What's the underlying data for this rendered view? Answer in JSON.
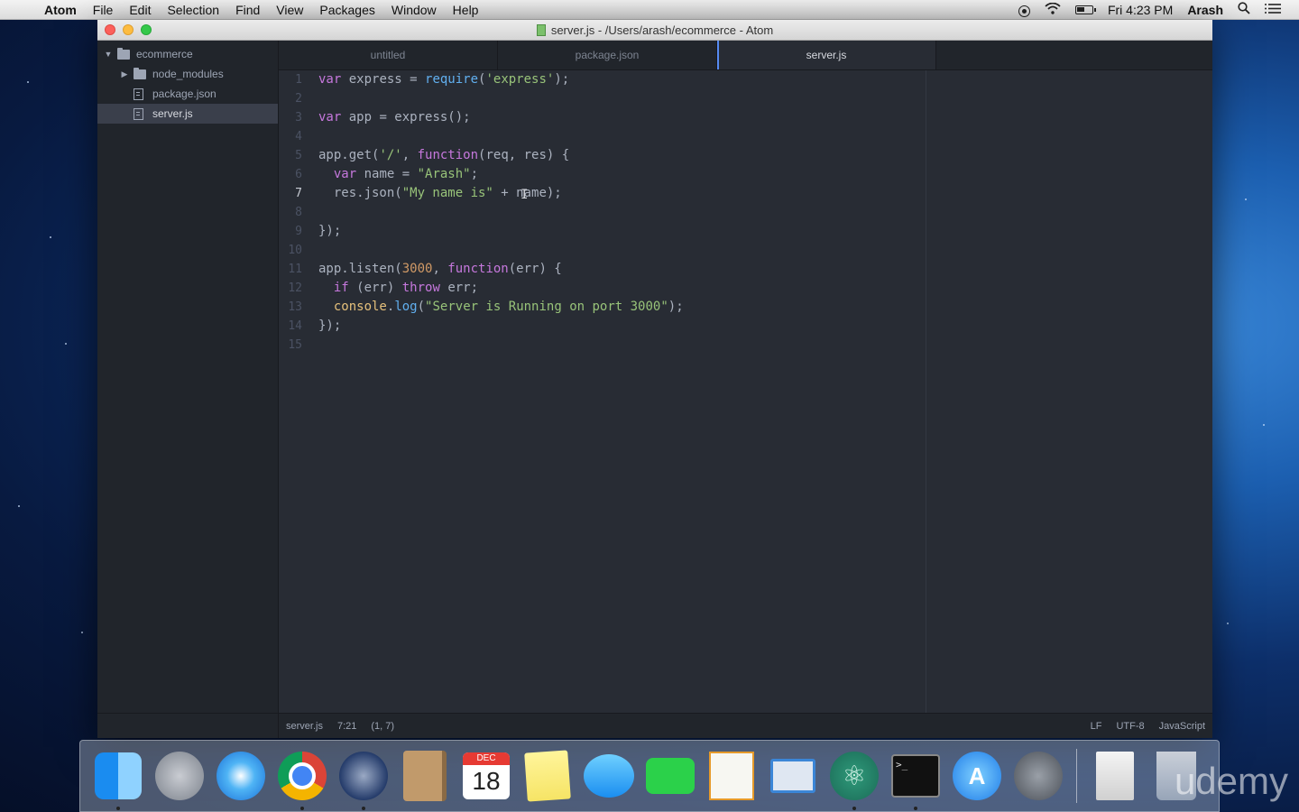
{
  "menubar": {
    "app": "Atom",
    "items": [
      "File",
      "Edit",
      "Selection",
      "Find",
      "View",
      "Packages",
      "Window",
      "Help"
    ],
    "clock": "Fri 4:23 PM",
    "user": "Arash"
  },
  "window": {
    "title": "server.js - /Users/arash/ecommerce - Atom"
  },
  "tree": {
    "root": "ecommerce",
    "items": [
      {
        "label": "node_modules",
        "type": "folder"
      },
      {
        "label": "package.json",
        "type": "file"
      },
      {
        "label": "server.js",
        "type": "file",
        "selected": true
      }
    ]
  },
  "tabs": [
    {
      "label": "untitled"
    },
    {
      "label": "package.json"
    },
    {
      "label": "server.js",
      "active": true
    }
  ],
  "editor": {
    "cursor_line": 7,
    "colors": {
      "keyword": "#c678dd",
      "string": "#98c379",
      "func": "#61afef",
      "number": "#d19a66",
      "plain": "#abb2bf",
      "object": "#e5c07b"
    },
    "lines": [
      [
        {
          "t": "var",
          "c": "keyword"
        },
        {
          "t": " express = ",
          "c": "plain"
        },
        {
          "t": "require",
          "c": "func"
        },
        {
          "t": "(",
          "c": "plain"
        },
        {
          "t": "'express'",
          "c": "string"
        },
        {
          "t": ");",
          "c": "plain"
        }
      ],
      [],
      [
        {
          "t": "var",
          "c": "keyword"
        },
        {
          "t": " app = express();",
          "c": "plain"
        }
      ],
      [],
      [
        {
          "t": "app.get(",
          "c": "plain"
        },
        {
          "t": "'/'",
          "c": "string"
        },
        {
          "t": ", ",
          "c": "plain"
        },
        {
          "t": "function",
          "c": "keyword"
        },
        {
          "t": "(req, res) {",
          "c": "plain"
        }
      ],
      [
        {
          "t": "  ",
          "c": "plain"
        },
        {
          "t": "var",
          "c": "keyword"
        },
        {
          "t": " name = ",
          "c": "plain"
        },
        {
          "t": "\"Arash\"",
          "c": "string"
        },
        {
          "t": ";",
          "c": "plain"
        }
      ],
      [
        {
          "t": "  res.json(",
          "c": "plain"
        },
        {
          "t": "\"My name is\"",
          "c": "string"
        },
        {
          "t": " + name);",
          "c": "plain"
        }
      ],
      [],
      [
        {
          "t": "});",
          "c": "plain"
        }
      ],
      [],
      [
        {
          "t": "app.listen(",
          "c": "plain"
        },
        {
          "t": "3000",
          "c": "number"
        },
        {
          "t": ", ",
          "c": "plain"
        },
        {
          "t": "function",
          "c": "keyword"
        },
        {
          "t": "(err) {",
          "c": "plain"
        }
      ],
      [
        {
          "t": "  ",
          "c": "plain"
        },
        {
          "t": "if",
          "c": "keyword"
        },
        {
          "t": " (err) ",
          "c": "plain"
        },
        {
          "t": "throw",
          "c": "keyword"
        },
        {
          "t": " err;",
          "c": "plain"
        }
      ],
      [
        {
          "t": "  ",
          "c": "plain"
        },
        {
          "t": "console",
          "c": "object"
        },
        {
          "t": ".",
          "c": "plain"
        },
        {
          "t": "log",
          "c": "func"
        },
        {
          "t": "(",
          "c": "plain"
        },
        {
          "t": "\"Server is Running on port 3000\"",
          "c": "string"
        },
        {
          "t": ");",
          "c": "plain"
        }
      ],
      [
        {
          "t": "});",
          "c": "plain"
        }
      ],
      []
    ]
  },
  "status": {
    "file": "server.js",
    "position": "7:21",
    "selection": "(1, 7)",
    "line_ending": "LF",
    "encoding": "UTF-8",
    "grammar": "JavaScript"
  },
  "dock": {
    "calendar_month": "DEC",
    "calendar_day": "18",
    "terminal_prompt": ">_",
    "atom_glyph": "⚛",
    "appstore_glyph": "A",
    "watermark": "udemy"
  }
}
